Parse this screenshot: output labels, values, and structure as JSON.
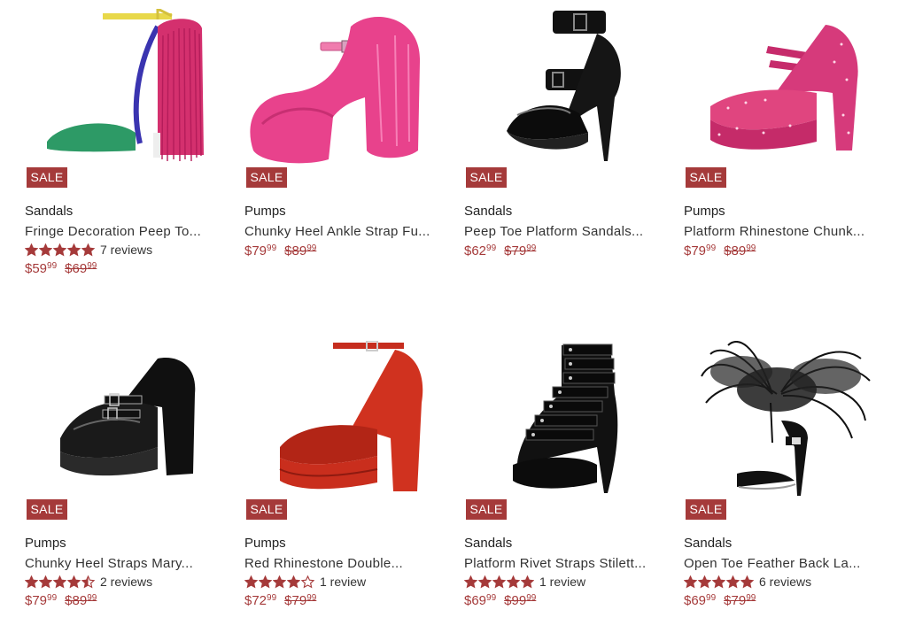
{
  "products": [
    {
      "badge": "SALE",
      "category": "Sandals",
      "name": "Fringe Decoration Peep To...",
      "stars": 5,
      "reviews": "7 reviews",
      "price_main": "$59",
      "price_cents": "99",
      "old_main": "$69",
      "old_cents": "99",
      "icon": "fringe-sandal"
    },
    {
      "badge": "SALE",
      "category": "Pumps",
      "name": "Chunky Heel Ankle Strap Fu...",
      "stars": 0,
      "reviews": "",
      "price_main": "$79",
      "price_cents": "99",
      "old_main": "$89",
      "old_cents": "99",
      "icon": "fur-pump"
    },
    {
      "badge": "SALE",
      "category": "Sandals",
      "name": "Peep Toe Platform Sandals...",
      "stars": 0,
      "reviews": "",
      "price_main": "$62",
      "price_cents": "99",
      "old_main": "$79",
      "old_cents": "99",
      "icon": "black-platform-sandal"
    },
    {
      "badge": "SALE",
      "category": "Pumps",
      "name": "Platform Rhinestone Chunk...",
      "stars": 0,
      "reviews": "",
      "price_main": "$79",
      "price_cents": "99",
      "old_main": "$89",
      "old_cents": "99",
      "icon": "pink-rhinestone-pump"
    },
    {
      "badge": "SALE",
      "category": "Pumps",
      "name": "Chunky Heel Straps Mary...",
      "stars": 4.5,
      "reviews": "2 reviews",
      "price_main": "$79",
      "price_cents": "99",
      "old_main": "$89",
      "old_cents": "99",
      "icon": "black-mary-jane"
    },
    {
      "badge": "SALE",
      "category": "Pumps",
      "name": "Red Rhinestone Double...",
      "stars": 4,
      "reviews": "1 review",
      "price_main": "$72",
      "price_cents": "99",
      "old_main": "$79",
      "old_cents": "99",
      "icon": "red-platform-pump"
    },
    {
      "badge": "SALE",
      "category": "Sandals",
      "name": "Platform Rivet Straps Stilett...",
      "stars": 5,
      "reviews": "1 review",
      "price_main": "$69",
      "price_cents": "99",
      "old_main": "$99",
      "old_cents": "99",
      "icon": "rivet-strap-sandal"
    },
    {
      "badge": "SALE",
      "category": "Sandals",
      "name": "Open Toe Feather Back La...",
      "stars": 5,
      "reviews": "6 reviews",
      "price_main": "$69",
      "price_cents": "99",
      "old_main": "$79",
      "old_cents": "99",
      "icon": "feather-sandal"
    }
  ],
  "colors": {
    "accent": "#a53a3a",
    "star": "#a53a3a"
  }
}
